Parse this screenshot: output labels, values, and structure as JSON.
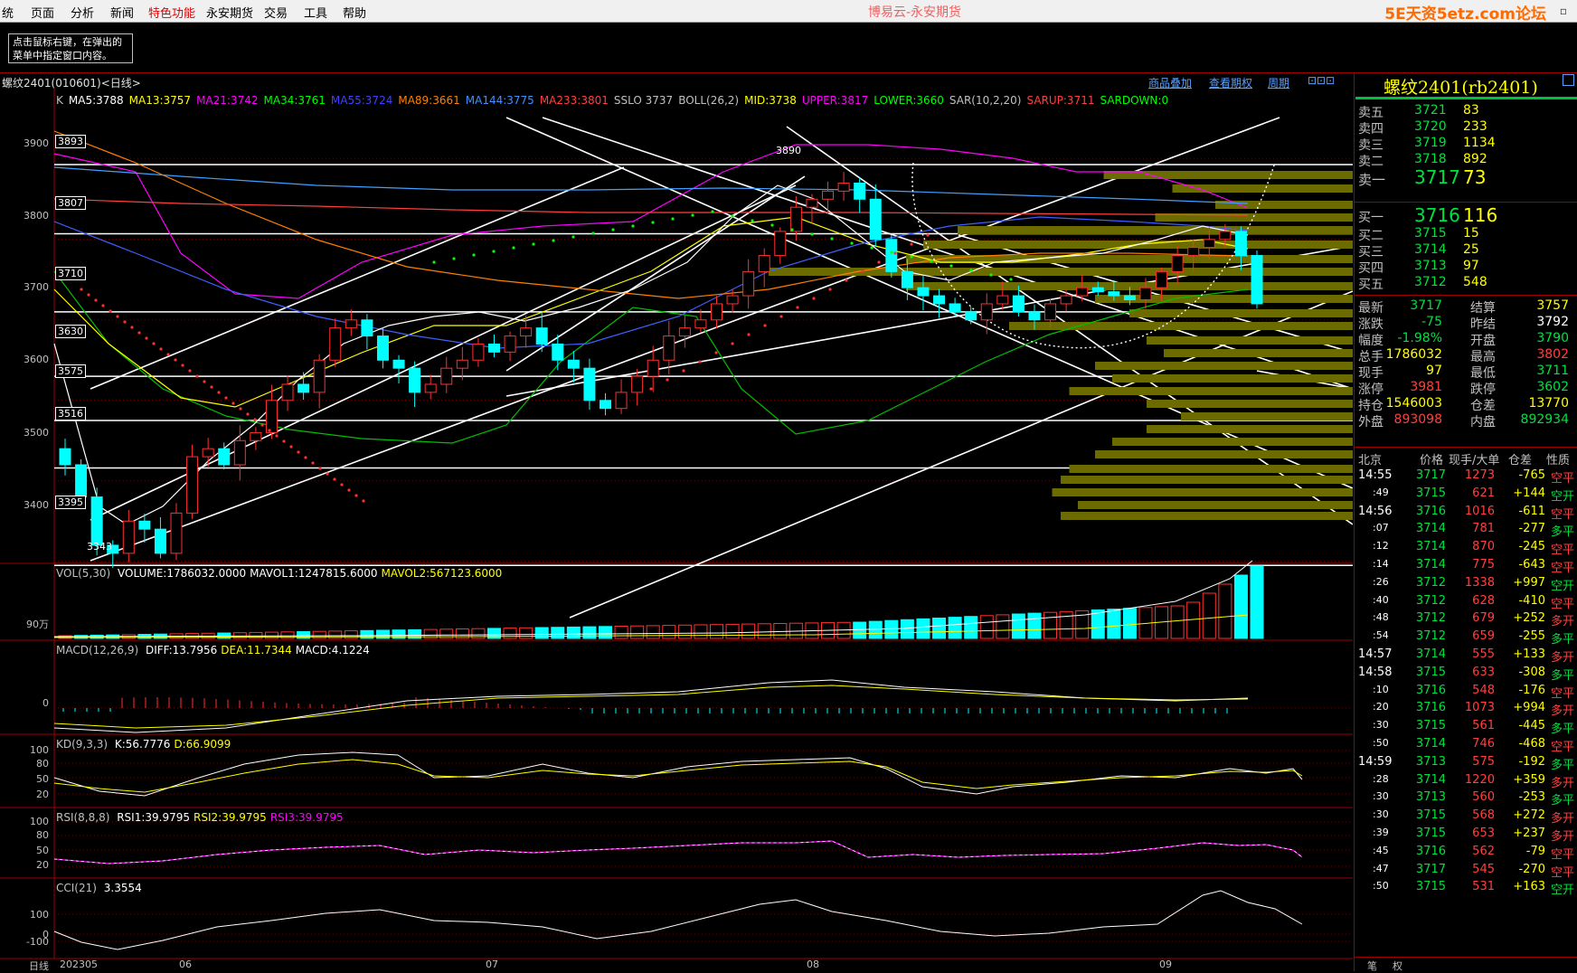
{
  "menu": {
    "items": [
      "统",
      "页面",
      "分析",
      "新闻",
      "特色功能",
      "永安期货",
      "交易",
      "工具",
      "帮助"
    ],
    "active_index": 4,
    "app_title": "博易云-永安期货",
    "watermark": "5E天资5etz.com论坛"
  },
  "hint": {
    "line1": "点击鼠标右键，在弹出的",
    "line2": "菜单中指定窗口内容。"
  },
  "chart": {
    "title": "螺纹2401(010601)<日线>",
    "links": [
      "商品叠加",
      "查看期权",
      "周期"
    ],
    "ma_legend": [
      {
        "text": "K",
        "color": "#c0c0c0"
      },
      {
        "text": "MA5:3788",
        "color": "#ffffff"
      },
      {
        "text": "MA13:3757",
        "color": "#ffff00"
      },
      {
        "text": "MA21:3742",
        "color": "#ff00ff"
      },
      {
        "text": "MA34:3761",
        "color": "#00ff00"
      },
      {
        "text": "MA55:3724",
        "color": "#4040ff"
      },
      {
        "text": "MA89:3661",
        "color": "#ff8000"
      },
      {
        "text": "MA144:3775",
        "color": "#4090ff"
      },
      {
        "text": "MA233:3801",
        "color": "#ff4040"
      },
      {
        "text": "SSLO 3737",
        "color": "#c0c0c0"
      },
      {
        "text": "BOLL(26,2)",
        "color": "#c0c0c0"
      },
      {
        "text": "MID:3738",
        "color": "#ffff00"
      },
      {
        "text": "UPPER:3817",
        "color": "#ff00ff"
      },
      {
        "text": "LOWER:3660",
        "color": "#00ff00"
      },
      {
        "text": "SAR(10,2,20)",
        "color": "#c0c0c0"
      },
      {
        "text": "SARUP:3711",
        "color": "#ff4040"
      },
      {
        "text": "SARDOWN:0",
        "color": "#00ff00"
      }
    ],
    "y_ticks": [
      "3900",
      "3800",
      "3700",
      "3600",
      "3500",
      "3400"
    ],
    "level_tags": [
      "3893",
      "3807",
      "3710",
      "3630",
      "3575",
      "3516",
      "3395"
    ],
    "high_label": "3890",
    "low_label": "3343",
    "x_ticks": [
      "日线",
      "202305",
      "06",
      "07",
      "08",
      "09"
    ]
  },
  "indicators": {
    "vol": {
      "label": "VOL(5,30)",
      "items": [
        {
          "text": "VOLUME:1786032.0000",
          "color": "#ffffff"
        },
        {
          "text": "MAVOL1:1247815.6000",
          "color": "#ffffff"
        },
        {
          "text": "MAVOL2:567123.6000",
          "color": "#ffff00"
        }
      ],
      "tick": "90万"
    },
    "macd": {
      "label": "MACD(12,26,9)",
      "items": [
        {
          "text": "DIFF:13.7956",
          "color": "#ffffff"
        },
        {
          "text": "DEA:11.7344",
          "color": "#ffff00"
        },
        {
          "text": "MACD:4.1224",
          "color": "#ffffff"
        }
      ],
      "tick": "0"
    },
    "kd": {
      "label": "KD(9,3,3)",
      "items": [
        {
          "text": "K:56.7776",
          "color": "#ffffff"
        },
        {
          "text": "D:66.9099",
          "color": "#ffff00"
        }
      ],
      "ticks": [
        "100",
        "80",
        "50",
        "20"
      ]
    },
    "rsi": {
      "label": "RSI(8,8,8)",
      "items": [
        {
          "text": "RSI1:39.9795",
          "color": "#ffffff"
        },
        {
          "text": "RSI2:39.9795",
          "color": "#ffff00"
        },
        {
          "text": "RSI3:39.9795",
          "color": "#ff00ff"
        }
      ],
      "ticks": [
        "100",
        "80",
        "50",
        "20"
      ]
    },
    "cci": {
      "label": "CCI(21)",
      "items": [
        {
          "text": "3.3554",
          "color": "#ffffff"
        }
      ],
      "ticks": [
        "100",
        "0",
        "-100"
      ]
    }
  },
  "quote": {
    "name": "螺纹2401(rb2401)",
    "asks": [
      {
        "label": "卖五",
        "price": "3721",
        "vol": "83"
      },
      {
        "label": "卖四",
        "price": "3720",
        "vol": "233"
      },
      {
        "label": "卖三",
        "price": "3719",
        "vol": "1134"
      },
      {
        "label": "卖二",
        "price": "3718",
        "vol": "892"
      },
      {
        "label": "卖一",
        "price": "3717",
        "vol": "73"
      }
    ],
    "bids": [
      {
        "label": "买一",
        "price": "3716",
        "vol": "116"
      },
      {
        "label": "买二",
        "price": "3715",
        "vol": "15"
      },
      {
        "label": "买三",
        "price": "3714",
        "vol": "25"
      },
      {
        "label": "买四",
        "price": "3713",
        "vol": "97"
      },
      {
        "label": "买五",
        "price": "3712",
        "vol": "548"
      }
    ],
    "stats": [
      {
        "l1": "最新",
        "v1": "3717",
        "c1": "#00e040",
        "l2": "结算",
        "v2": "3757",
        "c2": "#ffff00"
      },
      {
        "l1": "涨跌",
        "v1": "-75",
        "c1": "#00e040",
        "l2": "昨结",
        "v2": "3792",
        "c2": "#ffffff"
      },
      {
        "l1": "幅度",
        "v1": "-1.98%",
        "c1": "#00e040",
        "l2": "开盘",
        "v2": "3790",
        "c2": "#00e040"
      },
      {
        "l1": "总手",
        "v1": "1786032",
        "c1": "#ffff00",
        "l2": "最高",
        "v2": "3802",
        "c2": "#ff4040"
      },
      {
        "l1": "现手",
        "v1": "97",
        "c1": "#ffff00",
        "l2": "最低",
        "v2": "3711",
        "c2": "#00e040"
      },
      {
        "l1": "涨停",
        "v1": "3981",
        "c1": "#ff4040",
        "l2": "跌停",
        "v2": "3602",
        "c2": "#00e040"
      },
      {
        "l1": "持仓",
        "v1": "1546003",
        "c1": "#ffff00",
        "l2": "仓差",
        "v2": "13770",
        "c2": "#ffff00"
      },
      {
        "l1": "外盘",
        "v1": "893098",
        "c1": "#ff4040",
        "l2": "内盘",
        "v2": "892934",
        "c2": "#00e040"
      }
    ],
    "ticks_header": [
      "北京",
      "价格",
      "现手/大单",
      "仓差",
      "性质"
    ],
    "ticks": [
      {
        "t": "14:55",
        "p": "3717",
        "v": "1273",
        "d": "-765",
        "k": "空平",
        "kc": "#ff4040"
      },
      {
        "t": ":49",
        "p": "3715",
        "v": "621",
        "d": "+144",
        "k": "空开",
        "kc": "#00e040"
      },
      {
        "t": "14:56",
        "p": "3716",
        "v": "1016",
        "d": "-611",
        "k": "空平",
        "kc": "#ff4040"
      },
      {
        "t": ":07",
        "p": "3714",
        "v": "781",
        "d": "-277",
        "k": "多平",
        "kc": "#00e040"
      },
      {
        "t": ":12",
        "p": "3714",
        "v": "870",
        "d": "-245",
        "k": "空平",
        "kc": "#ff4040"
      },
      {
        "t": ":14",
        "p": "3714",
        "v": "775",
        "d": "-643",
        "k": "空平",
        "kc": "#ff4040"
      },
      {
        "t": ":26",
        "p": "3712",
        "v": "1338",
        "d": "+997",
        "k": "空开",
        "kc": "#00e040"
      },
      {
        "t": ":40",
        "p": "3712",
        "v": "628",
        "d": "-410",
        "k": "空平",
        "kc": "#ff4040"
      },
      {
        "t": ":48",
        "p": "3712",
        "v": "679",
        "d": "+252",
        "k": "多开",
        "kc": "#ff4040"
      },
      {
        "t": ":54",
        "p": "3712",
        "v": "659",
        "d": "-255",
        "k": "多平",
        "kc": "#00e040"
      },
      {
        "t": "14:57",
        "p": "3714",
        "v": "555",
        "d": "+133",
        "k": "多开",
        "kc": "#ff4040"
      },
      {
        "t": "14:58",
        "p": "3715",
        "v": "633",
        "d": "-308",
        "k": "多平",
        "kc": "#00e040"
      },
      {
        "t": ":10",
        "p": "3716",
        "v": "548",
        "d": "-176",
        "k": "空平",
        "kc": "#ff4040"
      },
      {
        "t": ":20",
        "p": "3716",
        "v": "1073",
        "d": "+994",
        "k": "多开",
        "kc": "#ff4040"
      },
      {
        "t": ":30",
        "p": "3715",
        "v": "561",
        "d": "-445",
        "k": "多平",
        "kc": "#00e040"
      },
      {
        "t": ":50",
        "p": "3714",
        "v": "746",
        "d": "-468",
        "k": "空平",
        "kc": "#ff4040"
      },
      {
        "t": "14:59",
        "p": "3713",
        "v": "575",
        "d": "-192",
        "k": "多平",
        "kc": "#00e040"
      },
      {
        "t": ":28",
        "p": "3714",
        "v": "1220",
        "d": "+359",
        "k": "多开",
        "kc": "#ff4040"
      },
      {
        "t": ":30",
        "p": "3713",
        "v": "560",
        "d": "-253",
        "k": "多平",
        "kc": "#00e040"
      },
      {
        "t": ":30",
        "p": "3715",
        "v": "568",
        "d": "+272",
        "k": "多开",
        "kc": "#ff4040"
      },
      {
        "t": ":39",
        "p": "3715",
        "v": "653",
        "d": "+237",
        "k": "多开",
        "kc": "#ff4040"
      },
      {
        "t": ":45",
        "p": "3716",
        "v": "562",
        "d": "-79",
        "k": "空平",
        "kc": "#ff4040"
      },
      {
        "t": ":47",
        "p": "3717",
        "v": "545",
        "d": "-270",
        "k": "空平",
        "kc": "#ff4040"
      },
      {
        "t": ":50",
        "p": "3715",
        "v": "531",
        "d": "+163",
        "k": "空开",
        "kc": "#00e040"
      }
    ],
    "bottom_tabs": [
      "笔",
      "权"
    ]
  }
}
